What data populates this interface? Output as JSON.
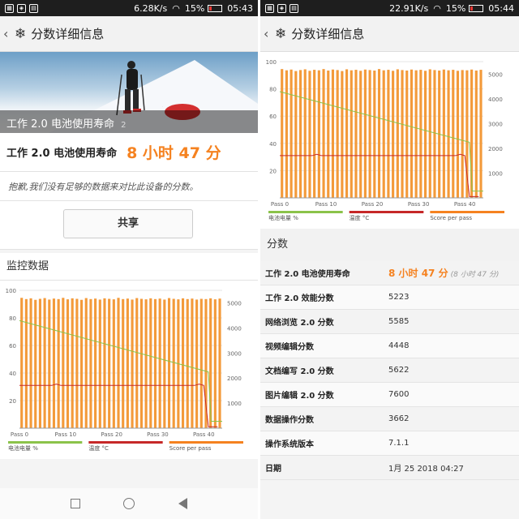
{
  "status_left": {
    "speed": "6.28K/s",
    "battery": "15%",
    "time": "05:43"
  },
  "status_right": {
    "speed": "22.91K/s",
    "battery": "15%",
    "time": "05:44"
  },
  "header": {
    "title": "分数详细信息"
  },
  "hero": {
    "caption": "工作 2.0 电池使用寿命",
    "caption_tail": "2"
  },
  "battery_life": {
    "label": "工作 2.0 电池使用寿命",
    "value": "8 小时 47 分"
  },
  "note": "抱歉,我们没有足够的数据来对比此设备的分数。",
  "share_label": "共享",
  "monitor_title": "监控数据",
  "scores_title": "分数",
  "scores": [
    {
      "label": "工作 2.0 电池使用寿命",
      "value": "8 小时 47 分",
      "sub": "(8 小时 47 分)"
    },
    {
      "label": "工作 2.0 效能分数",
      "value": "5223"
    },
    {
      "label": "网络浏览 2.0 分数",
      "value": "5585"
    },
    {
      "label": "视频编辑分数",
      "value": "4448"
    },
    {
      "label": "文档编写 2.0 分数",
      "value": "5622"
    },
    {
      "label": "图片编辑 2.0 分数",
      "value": "7600"
    },
    {
      "label": "数据操作分数",
      "value": "3662"
    },
    {
      "label": "操作系统版本",
      "value": "7.1.1"
    },
    {
      "label": "日期",
      "value": "1月 25 2018 04:27"
    }
  ],
  "colors": {
    "accent": "#f58220",
    "bar": "#f39a3a",
    "battery_line": "#8bc34a",
    "temp_line": "#c62828"
  },
  "chart_data": {
    "type": "bar",
    "x_tick_labels": [
      "Pass 0",
      "Pass 10",
      "Pass 20",
      "Pass 30",
      "Pass 40"
    ],
    "y_left_ticks": [
      20,
      40,
      60,
      80,
      100
    ],
    "y_right_ticks": [
      1000,
      2000,
      3000,
      4000,
      5000
    ],
    "y_left_range": [
      0,
      100
    ],
    "y_right_range": [
      0,
      5500
    ],
    "bar_values": [
      5200,
      5150,
      5180,
      5120,
      5160,
      5190,
      5130,
      5170,
      5150,
      5200,
      5140,
      5180,
      5160,
      5120,
      5190,
      5150,
      5170,
      5130,
      5180,
      5160,
      5140,
      5200,
      5150,
      5170,
      5130,
      5190,
      5160,
      5140,
      5180,
      5150,
      5170,
      5130,
      5190,
      5160,
      5140,
      5180,
      5150,
      5170,
      5130,
      5160,
      5150,
      5180,
      5140,
      5170
    ],
    "battery_pct": [
      78,
      5
    ],
    "battery_drop_pass": 41,
    "temperature": [
      31,
      31,
      31,
      31,
      31,
      31,
      31,
      31,
      32,
      31,
      31,
      31,
      31,
      31,
      31,
      31,
      31,
      31,
      31,
      31,
      31,
      31,
      31,
      31,
      31,
      31,
      31,
      31,
      31,
      31,
      31,
      31,
      31,
      31,
      31,
      31,
      31,
      31,
      31,
      32,
      31,
      1,
      1,
      1
    ],
    "legend": [
      "电池电量 %",
      "温度 °C",
      "Score per pass"
    ],
    "grid": true
  }
}
